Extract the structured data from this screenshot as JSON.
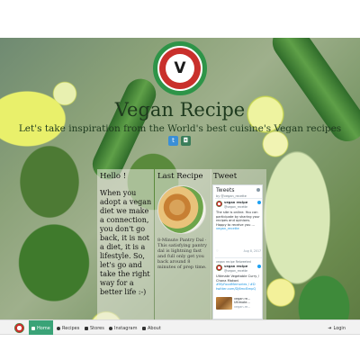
{
  "site": {
    "title": "Vegan Recipe",
    "tagline": "Let's take inspiration from the World's best cuisine's Vegan recipes",
    "logo_letter": "V"
  },
  "social": [
    {
      "name": "twitter-icon",
      "glyph": "t"
    },
    {
      "name": "instagram-icon",
      "glyph": "◘"
    }
  ],
  "hello": {
    "title": "Hello !",
    "text": "When you adopt a vegan diet we make a connection, you don't go back, it is not a diet, it is a lifestyle. So, let's go and take the right way for a better life :-)"
  },
  "recipe": {
    "title": "Last Recipe",
    "text": "8-Minute Pantry Dal · This satisfying pantry dal is lightning fast and full only get you back around 8 minutes of prep time."
  },
  "tweet_section": {
    "title": "Tweet",
    "widget_title": "Tweets",
    "widget_by": "by @vegan_recette",
    "tweets": [
      {
        "name": "vegan recipe",
        "handle": "@vegan_recette",
        "body": "The site is online. You can participate by sharing your recipes and opinions. Happy to receive you ...",
        "link": "vegan_recette",
        "date": "Aug 8, 2017"
      },
      {
        "retweet": "vegan recipe Retweeted",
        "name": "vegan recipe",
        "handle": "@vegan_recette",
        "body": "Ultimate Vegetable Curry / Chana Makani",
        "link": "#MyFoodMemories / #D",
        "link2": "twitter.com/DJ6mcBmpQ",
        "card_title": "vegan re...",
        "card_text": "Ultimate...",
        "card_src": "vegan-re..."
      }
    ]
  },
  "nav": {
    "items": [
      {
        "label": "Home",
        "active": true
      },
      {
        "label": "Recipes",
        "active": false
      },
      {
        "label": "Stores",
        "active": false
      },
      {
        "label": "Instagram",
        "active": false
      },
      {
        "label": "About",
        "active": false
      }
    ],
    "login": "Login"
  },
  "colors": {
    "accent_green": "#3aa377",
    "logo_red": "#c9302c",
    "logo_green": "#2e9448"
  }
}
